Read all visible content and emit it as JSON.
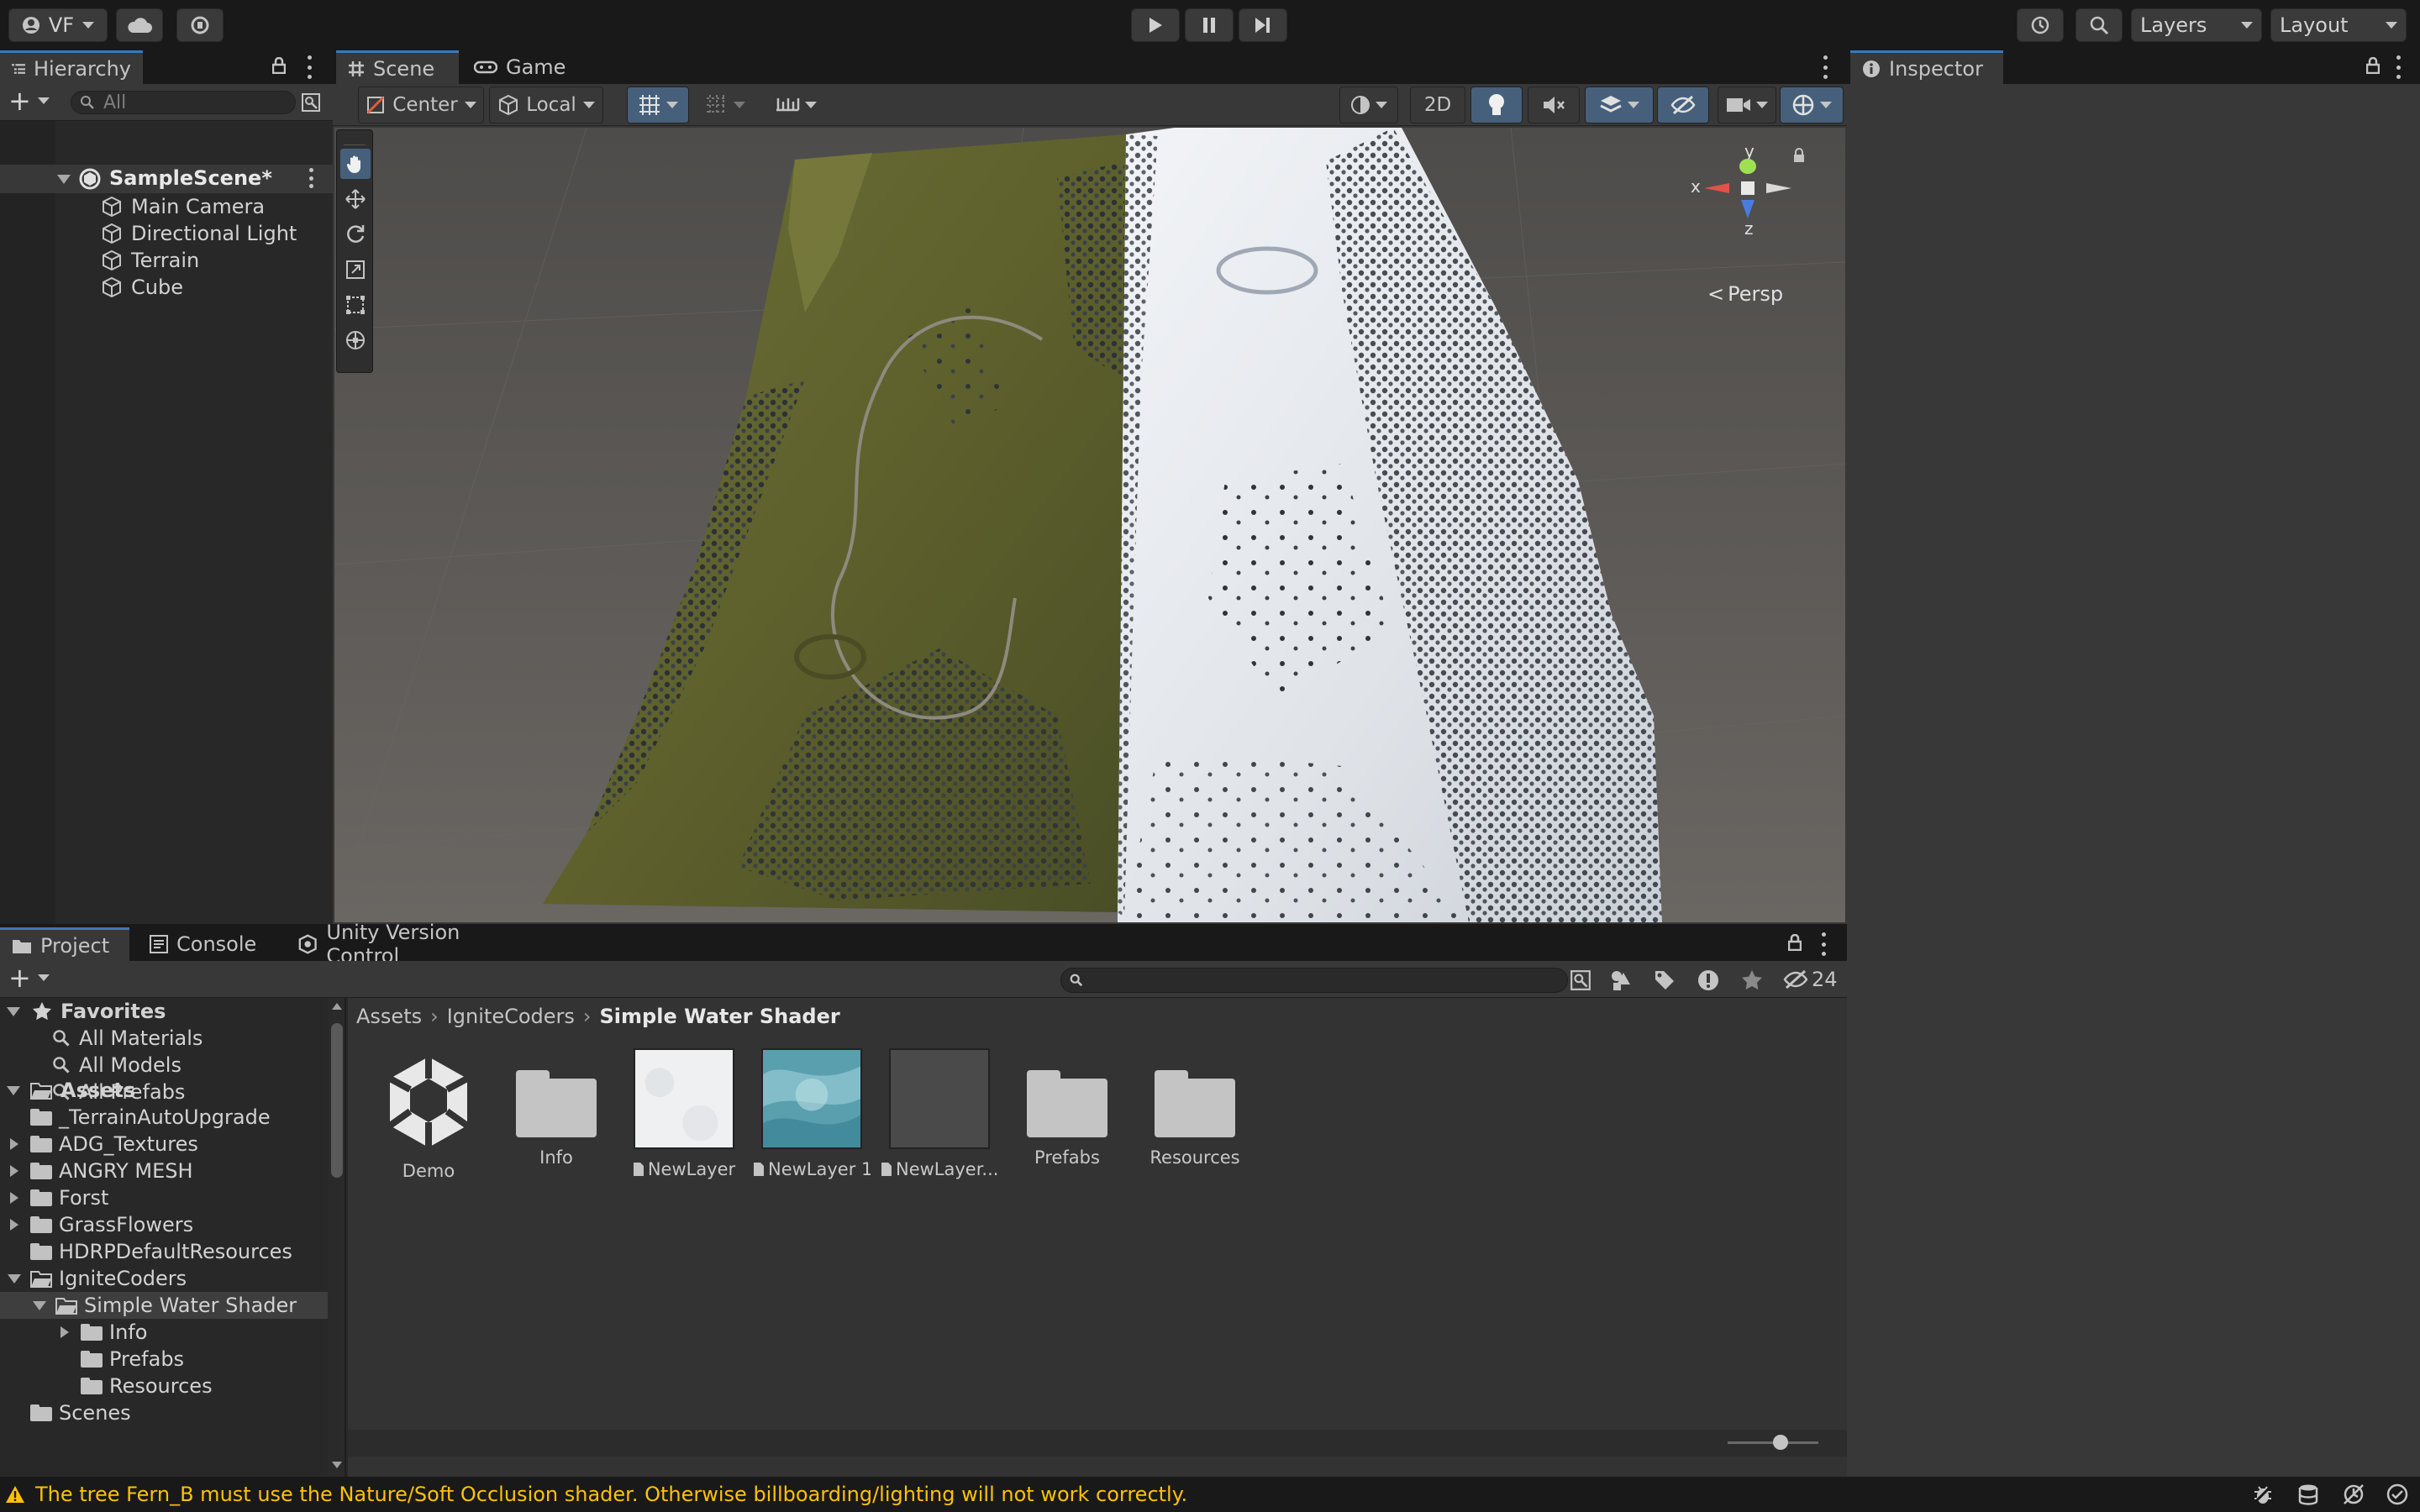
{
  "toolbar": {
    "account_label": "VF",
    "layers_label": "Layers",
    "layout_label": "Layout"
  },
  "hierarchy": {
    "tab_label": "Hierarchy",
    "search_placeholder": "All",
    "scene_name": "SampleScene*",
    "objects": [
      "Main Camera",
      "Directional Light",
      "Terrain",
      "Cube"
    ]
  },
  "scene_view": {
    "tabs": [
      "Scene",
      "Game"
    ],
    "pivot_label": "Center",
    "space_label": "Local",
    "mode_2d_label": "2D",
    "gizmo": {
      "y": "y",
      "x": "x",
      "z": "z",
      "projection": "Persp"
    }
  },
  "inspector": {
    "tab_label": "Inspector"
  },
  "project": {
    "tabs": [
      "Project",
      "Console",
      "Unity Version Control"
    ],
    "hidden_count": "24",
    "favorites_label": "Favorites",
    "favorites": [
      "All Materials",
      "All Models",
      "All Prefabs"
    ],
    "assets_label": "Assets",
    "tree": [
      {
        "label": "_TerrainAutoUpgrade",
        "indent": 1,
        "arrow": "none"
      },
      {
        "label": "ADG_Textures",
        "indent": 1,
        "arrow": "right"
      },
      {
        "label": "ANGRY MESH",
        "indent": 1,
        "arrow": "right"
      },
      {
        "label": "Forst",
        "indent": 1,
        "arrow": "right"
      },
      {
        "label": "GrassFlowers",
        "indent": 1,
        "arrow": "right"
      },
      {
        "label": "HDRPDefaultResources",
        "indent": 1,
        "arrow": "none"
      },
      {
        "label": "IgniteCoders",
        "indent": 1,
        "arrow": "down"
      },
      {
        "label": "Simple Water Shader",
        "indent": 2,
        "arrow": "down",
        "selected": true
      },
      {
        "label": "Info",
        "indent": 3,
        "arrow": "right"
      },
      {
        "label": "Prefabs",
        "indent": 3,
        "arrow": "none"
      },
      {
        "label": "Resources",
        "indent": 3,
        "arrow": "none"
      },
      {
        "label": "Scenes",
        "indent": 1,
        "arrow": "none"
      }
    ],
    "breadcrumb": [
      "Assets",
      "IgniteCoders",
      "Simple Water Shader"
    ],
    "assets": [
      {
        "label": "Demo",
        "kind": "unity-logo"
      },
      {
        "label": "Info",
        "kind": "folder"
      },
      {
        "label": "NewLayer",
        "kind": "texture-white"
      },
      {
        "label": "NewLayer 1",
        "kind": "texture-water"
      },
      {
        "label": "NewLayer...",
        "kind": "texture-dark"
      },
      {
        "label": "Prefabs",
        "kind": "folder"
      },
      {
        "label": "Resources",
        "kind": "folder"
      }
    ]
  },
  "status": {
    "message": "The tree Fern_B must use the Nature/Soft Occlusion shader. Otherwise billboarding/lighting will not work correctly.",
    "warning_color": "#ffc107"
  },
  "colors": {
    "accent": "#3a79bb",
    "grass": "#6b6e33",
    "snow": "#e8ebef"
  }
}
